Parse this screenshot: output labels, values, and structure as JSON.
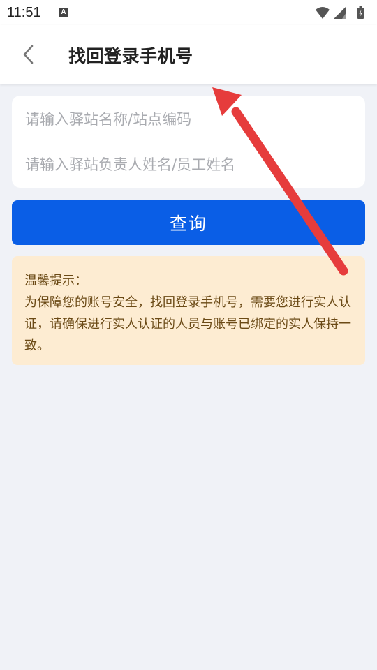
{
  "status_bar": {
    "time": "11:51",
    "notification_icon_letter": "A",
    "icons": [
      "wifi-icon",
      "signal-icon",
      "battery-icon"
    ]
  },
  "header": {
    "title": "找回登录手机号",
    "back_icon": "chevron-left-icon"
  },
  "form": {
    "station_placeholder": "请输入驿站名称/站点编码",
    "station_value": "",
    "person_placeholder": "请输入驿站负责人姓名/员工姓名",
    "person_value": ""
  },
  "query_button": {
    "label": "查询"
  },
  "tips": {
    "title": "温馨提示：",
    "body": "为保障您的账号安全，找回登录手机号，需要您进行实人认证，请确保进行实人认证的人员与账号已绑定的实人保持一致。"
  },
  "colors": {
    "primary": "#0a5ee6",
    "page_background": "#f0f2f7",
    "tips_background": "#fdecd2",
    "tips_text": "#6b4a16",
    "annotation_arrow": "#e63c3c"
  }
}
